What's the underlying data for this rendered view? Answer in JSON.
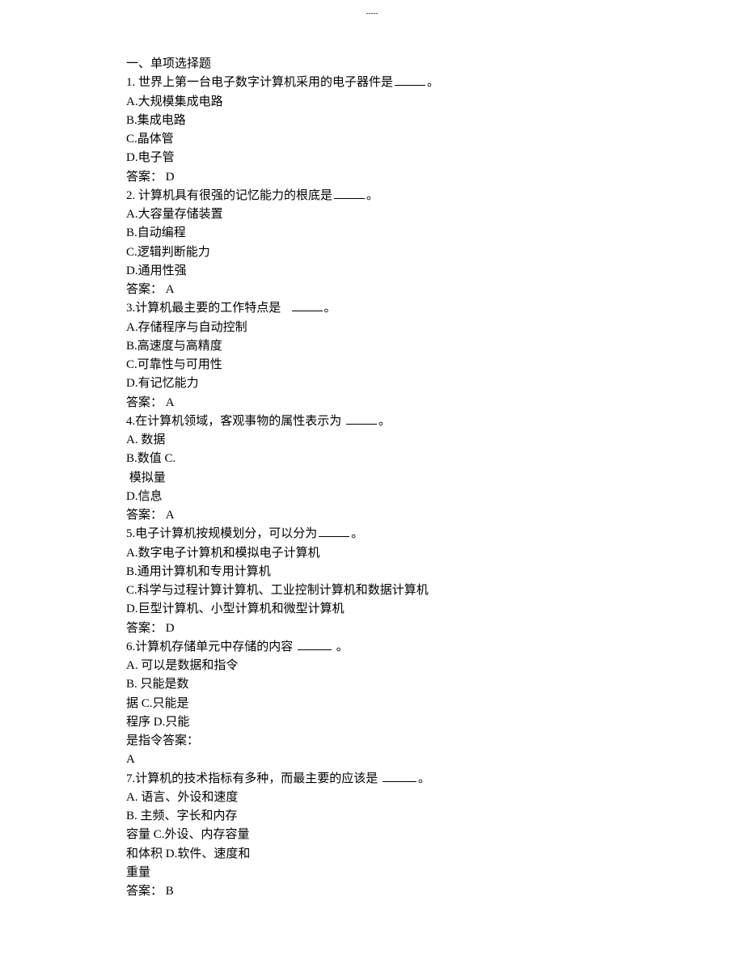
{
  "header_marker": "-----",
  "section_title": "一、单项选择题",
  "questions": [
    {
      "stem_pre": "1. 世界上第一台电子数字计算机采用的电子器件是",
      "stem_post": "。",
      "options": [
        "A.大规模集成电路",
        "B.集成电路",
        "C.晶体管",
        "D.电子管"
      ],
      "answer": "答案： D"
    },
    {
      "stem_pre": "2. 计算机具有很强的记忆能力的根底是",
      "stem_post": "。",
      "options": [
        "A.大容量存储装置",
        "B.自动编程",
        "C.逻辑判断能力",
        "D.通用性强"
      ],
      "answer": "答案： A"
    },
    {
      "stem_pre": "3.计算机最主要的工作特点是   ",
      "stem_post": "。",
      "options": [
        "A.存储程序与自动控制",
        "B.高速度与高精度",
        "C.可靠性与可用性",
        "D.有记忆能力"
      ],
      "answer": "答案： A"
    },
    {
      "stem_pre": "4.在计算机领域，客观事物的属性表示为 ",
      "stem_post": "。",
      "options": [
        "A. 数据",
        "B.数值 C.",
        " 模拟量",
        "D.信息"
      ],
      "answer": "答案： A"
    },
    {
      "stem_pre": "5.电子计算机按规模划分，可以分为",
      "stem_post": "。",
      "options": [
        "A.数字电子计算机和模拟电子计算机",
        "B.通用计算机和专用计算机",
        "C.科学与过程计算计算机、工业控制计算机和数据计算机",
        "D.巨型计算机、小型计算机和微型计算机"
      ],
      "answer": "答案： D"
    },
    {
      "stem_pre": "6.计算机存储单元中存储的内容 ",
      "stem_post": " 。",
      "options": [
        "A. 可以是数据和指令",
        "B. 只能是数",
        "据 C.只能是",
        "程序 D.只能",
        "是指令答案：",
        "A"
      ],
      "answer": ""
    },
    {
      "stem_pre": "7.计算机的技术指标有多种，而最主要的应该是 ",
      "stem_post": "。",
      "options": [
        "A. 语言、外设和速度",
        "B. 主频、字长和内存",
        "容量 C.外设、内存容量",
        "和体积 D.软件、速度和",
        "重量"
      ],
      "answer": "答案： B"
    }
  ]
}
